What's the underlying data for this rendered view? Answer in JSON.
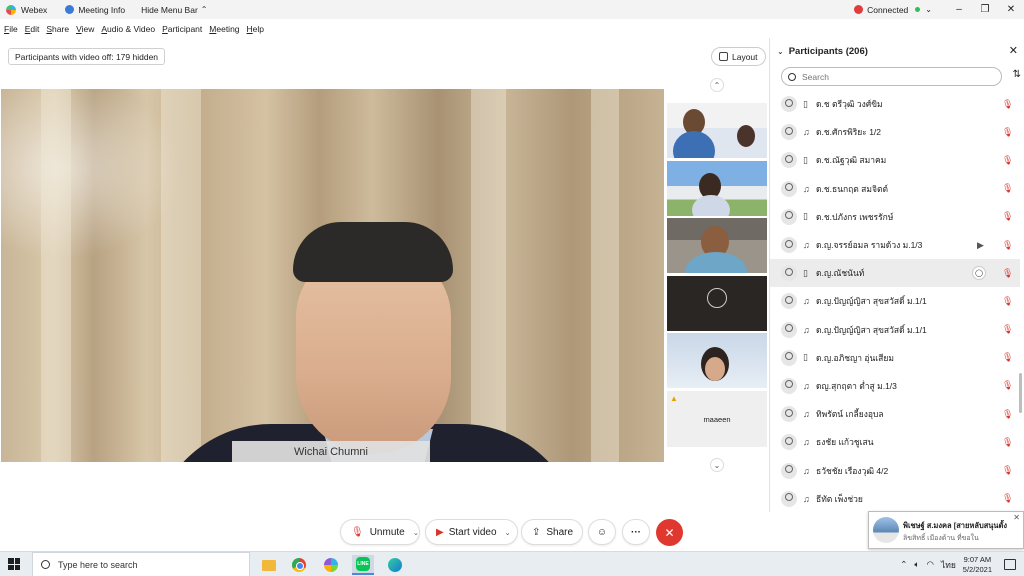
{
  "titlebar": {
    "app_name": "Webex",
    "meeting_info": "Meeting Info",
    "hide_menu_bar": "Hide Menu Bar",
    "connection": "Connected",
    "minimize": "–",
    "restore": "❐",
    "close": "✕"
  },
  "menu": [
    "File",
    "Edit",
    "Share",
    "View",
    "Audio & Video",
    "Participant",
    "Meeting",
    "Help"
  ],
  "stage": {
    "hidden_notice": "Participants with video off: 179 hidden",
    "layout_label": "Layout",
    "active_speaker": "Wichai Chumni",
    "thumbnail_name": "maaeen"
  },
  "panel": {
    "title": "Participants (206)",
    "search_placeholder": "Search",
    "participants": [
      {
        "name": "ด.ช ตรีวุฒิ วงศ์ขิม",
        "device": "phone",
        "video": false,
        "chat": false
      },
      {
        "name": "ด.ช.ศักรพิริยะ 1/2",
        "device": "headset",
        "video": false,
        "chat": false
      },
      {
        "name": "ด.ช.ณัฐวุฒิ สมาคม",
        "device": "phone",
        "video": false,
        "chat": false
      },
      {
        "name": "ด.ช.ธนกฤต สมจิตต์",
        "device": "headset",
        "video": false,
        "chat": false
      },
      {
        "name": "ด.ช.ปภังกร เพชรรักษ์",
        "device": "phone",
        "video": false,
        "chat": false
      },
      {
        "name": "ด.ญ.จรรย์อมล รามด้วง ม.1/3",
        "device": "headset",
        "video": true,
        "chat": false
      },
      {
        "name": "ด.ญ.ณัชนันท์",
        "device": "phone",
        "video": false,
        "chat": true
      },
      {
        "name": "ด.ญ.ปัญญ์ญิสา สุขสวัสดิ์ ม.1/1",
        "device": "headset",
        "video": false,
        "chat": false
      },
      {
        "name": "ด.ญ.ปัญญ์ญิสา สุขสวัสดิ์ ม.1/1",
        "device": "headset",
        "video": false,
        "chat": false
      },
      {
        "name": "ด.ญ.อภิชญา อุ่นเสียม",
        "device": "phone",
        "video": false,
        "chat": false
      },
      {
        "name": "ดญ.สุกฤตา ต่ำสู ม.1/3",
        "device": "headset",
        "video": false,
        "chat": false
      },
      {
        "name": "ทิพรัตน์ เกลี้ยงอุบล",
        "device": "headset",
        "video": false,
        "chat": false
      },
      {
        "name": "ธงชัย แก้วชูเสน",
        "device": "headset",
        "video": false,
        "chat": false
      },
      {
        "name": "ธวัชชัย เรืองวุฒิ 4/2",
        "device": "headset",
        "video": false,
        "chat": false
      },
      {
        "name": "ธีทัต เพ็งช่วย",
        "device": "headset",
        "video": false,
        "chat": false
      }
    ]
  },
  "controls": {
    "unmute": "Unmute",
    "start_video": "Start video",
    "share": "Share",
    "more": "···",
    "leave": "✕"
  },
  "toast": {
    "title": "พิเชษฐ์ ส.มงคล [สายหลับสนุนตั้ง",
    "subtitle": "ลิขสิทธิ์ เมืองด้าน ที่ขอใน"
  },
  "taskbar": {
    "search_placeholder": "Type here to search",
    "language": "ไทย",
    "time": "9:07 AM",
    "date": "5/2/2021"
  },
  "colors": {
    "accent_red": "#e0372f",
    "muted_red": "#d9342b",
    "connected_green": "#2fbf5a"
  }
}
